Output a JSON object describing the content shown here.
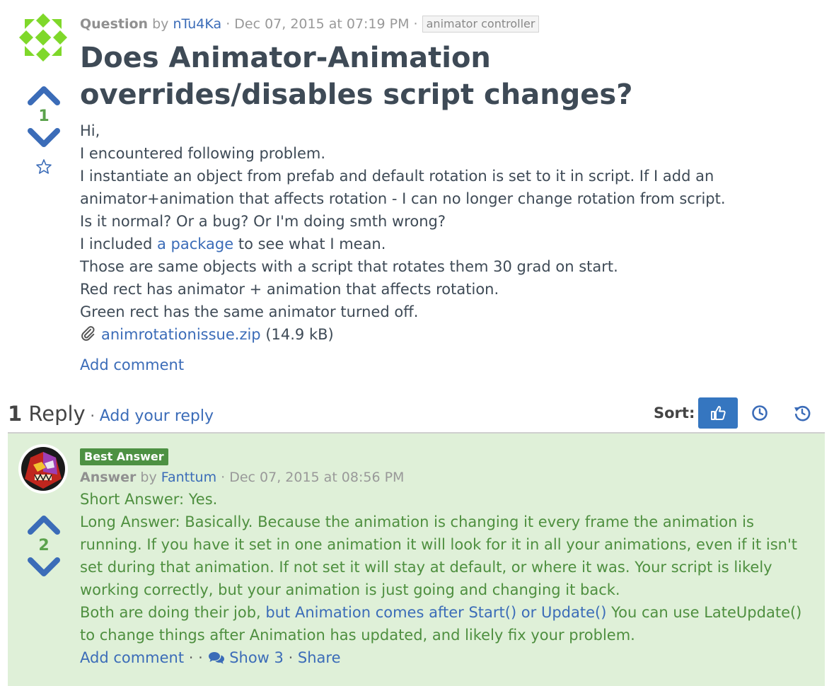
{
  "question": {
    "kind": "Question",
    "by": "by",
    "author": "nTu4Ka",
    "date": "· Dec 07, 2015 at 07:19 PM ·",
    "tag": "animator controller",
    "title": "Does Animator-Animation overrides/disables script changes?",
    "votes": "1",
    "body": {
      "line1": "Hi,",
      "line2": "I encountered following problem.",
      "line3": "I instantiate an object from prefab and default rotation is set to it in script. If I add an",
      "line4": "animator+animation that affects rotation - I can no longer change rotation from script.",
      "line5": "Is it normal? Or a bug? Or I'm doing smth wrong?",
      "line6_pre": "I included ",
      "line6_link": "a package",
      "line6_post": " to see what I mean.",
      "line7": "Those are same objects with a script that rotates them 30 grad on start.",
      "line8": "Red rect has animator + animation that affects rotation.",
      "line9": "Green rect has the same animator turned off."
    },
    "attachment": {
      "name": "animrotationissue.zip",
      "size": " (14.9 kB)"
    },
    "add_comment": "Add comment"
  },
  "replies": {
    "count": "1",
    "label": " Reply",
    "sep": " · ",
    "add_reply": "Add your reply",
    "sort_label": "Sort:"
  },
  "answer": {
    "badge": "Best Answer",
    "kind": "Answer",
    "by": "by",
    "author": "Fanttum",
    "date": "· Dec 07, 2015 at 08:56 PM",
    "votes": "2",
    "body": {
      "p1": "Short Answer: Yes.",
      "p2": "Long Answer: Basically. Because the animation is changing it every frame the animation is running. If you have it set in one animation it will look for it in all your animations, even if it isn't set during that animation. If not set it will stay at default, or where it was. Your script is likely working correctly, but your animation is just going and changing it back.",
      "p3_pre": "Both are doing their job, ",
      "p3_link": "but Animation comes after Start() or Update()",
      "p3_post": " You can use LateUpdate() to change things after Animation has updated, and likely fix your problem."
    },
    "actions": {
      "add_comment": "Add comment",
      "dot1": " · ",
      "dot2": " · ",
      "show": "Show 3",
      "dot3": " · ",
      "share": "Share"
    }
  },
  "colors": {
    "link": "#3b6cb8",
    "vote_arrow": "#3b6cb8",
    "vote_count": "#5ba24c",
    "answer_bg": "#dff0d8",
    "answer_text": "#4e8f3f",
    "best_badge": "#4d9143",
    "sort_active": "#3576c0"
  },
  "icons": {
    "upvote": "chevron-up-icon",
    "downvote": "chevron-down-icon",
    "favorite": "star-outline-icon",
    "attachment": "paperclip-icon",
    "sort_votes": "thumbs-up-icon",
    "sort_newest": "clock-icon",
    "sort_oldest": "history-icon",
    "comments": "comments-icon"
  }
}
